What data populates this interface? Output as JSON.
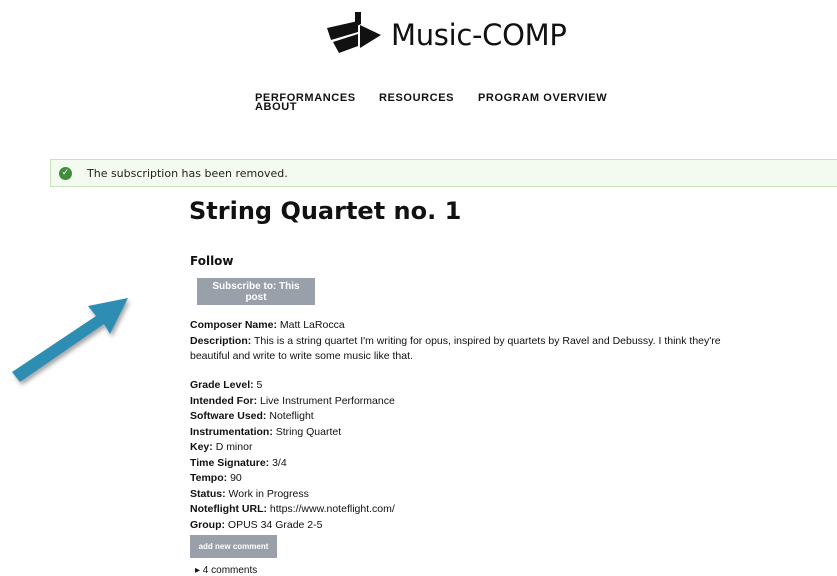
{
  "site": {
    "name": "Music-COMP"
  },
  "nav": {
    "performances": "PERFORMANCES",
    "resources": "RESOURCES",
    "program_overview": "PROGRAM OVERVIEW",
    "about": "ABOUT"
  },
  "alert": {
    "message": "The subscription has been removed."
  },
  "post": {
    "title": "String Quartet no. 1",
    "follow_label": "Follow",
    "subscribe_button": "Subscribe to: This post",
    "composer": {
      "label": "Composer Name:",
      "value": "Matt LaRocca"
    },
    "description": {
      "label": "Description:",
      "line1": "This is a string quartet I'm writing for opus, inspired by quartets by Ravel and Debussy. I think they're",
      "line2": "beautiful and write to write some music like that."
    },
    "fields": [
      {
        "label": "Grade Level:",
        "value": "5"
      },
      {
        "label": "Intended For:",
        "value": "Live Instrument Performance"
      },
      {
        "label": "Software Used:",
        "value": "Noteflight"
      },
      {
        "label": "Instrumentation:",
        "value": "String Quartet"
      },
      {
        "label": "Key:",
        "value": "D minor"
      },
      {
        "label": "Time Signature:",
        "value": "3/4"
      },
      {
        "label": "Tempo:",
        "value": "90"
      },
      {
        "label": "Status:",
        "value": "Work in Progress"
      },
      {
        "label": "Noteflight URL:",
        "value": "https://www.noteflight.com/"
      },
      {
        "label": "Group:",
        "value": "OPUS 34 Grade 2-5"
      }
    ],
    "add_comment_button": "add new comment",
    "comments_toggle": "▸ 4 comments"
  },
  "colors": {
    "arrow": "#2f8db3",
    "button": "#9aa0a9",
    "alert_bg": "#f3faef",
    "alert_icon": "#3f8f3a"
  }
}
